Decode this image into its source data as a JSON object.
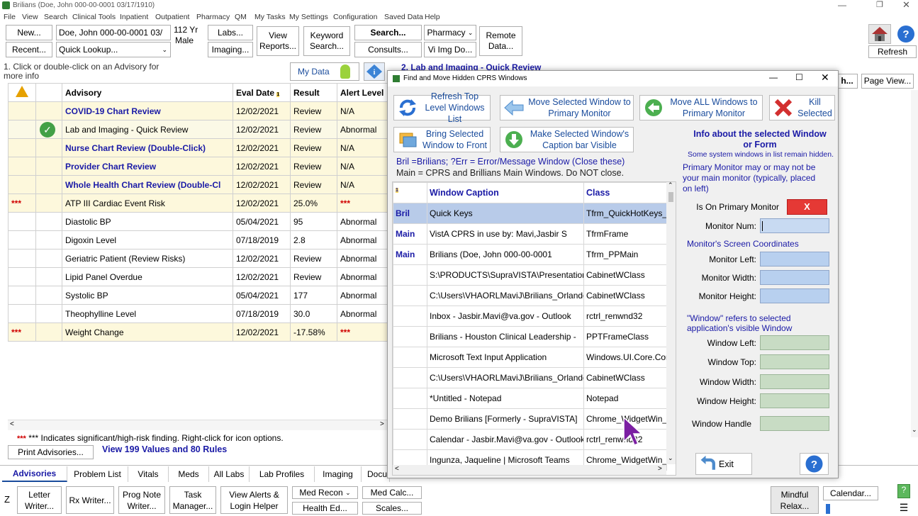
{
  "window": {
    "title": "Brilians (Doe, John  000-00-0001 03/17/1910)"
  },
  "menu": [
    "File",
    "View",
    "Search",
    "Clinical Tools",
    "Inpatient",
    "Outpatient",
    "Pharmacy",
    "QM",
    "My Tasks",
    "My Settings",
    "Configuration",
    "Saved Data",
    "Help"
  ],
  "toolbar": {
    "new": "New...",
    "recent": "Recent...",
    "patient": "Doe, John  000-00-0001  03/",
    "quick_lookup": "Quick Lookup...",
    "age": "112 Yr",
    "sex": "Male",
    "labs": "Labs...",
    "imaging": "Imaging...",
    "view_reports": "View Reports...",
    "keyword_search": "Keyword Search...",
    "search": "Search...",
    "consults": "Consults...",
    "pharmacy": "Pharmacy",
    "vi_img": "Vi Img Do...",
    "remote_data": "Remote Data...",
    "refresh": "Refresh"
  },
  "advisory": {
    "hint": "1. Click or double-click on an Advisory for more info",
    "my_data": "My Data",
    "right_panel_title": "2. Lab and Imaging - Quick Review",
    "right_btn": "h...",
    "page_view": "Page View...",
    "headers": {
      "advisory": "Advisory",
      "eval_date": "Eval Date",
      "result": "Result",
      "alert": "Alert Level"
    },
    "rows": [
      {
        "flag": "",
        "advisory": "COVID-19 Chart Review",
        "date": "12/02/2021",
        "result": "Review",
        "alert": "N/A"
      },
      {
        "flag": "",
        "advisory": "Lab and Imaging - Quick Review",
        "date": "12/02/2021",
        "result": "Review",
        "alert": "Abnormal"
      },
      {
        "flag": "",
        "advisory": "Nurse Chart Review (Double-Click)",
        "date": "12/02/2021",
        "result": "Review",
        "alert": "N/A"
      },
      {
        "flag": "",
        "advisory": "Provider Chart Review",
        "date": "12/02/2021",
        "result": "Review",
        "alert": "N/A"
      },
      {
        "flag": "",
        "advisory": "Whole Health Chart Review (Double-Cl",
        "date": "12/02/2021",
        "result": "Review",
        "alert": "N/A"
      },
      {
        "flag": "***",
        "advisory": "ATP III Cardiac Event Risk",
        "date": "12/02/2021",
        "result": "25.0%",
        "alert": "***"
      },
      {
        "flag": "",
        "advisory": "Diastolic BP",
        "date": "05/04/2021",
        "result": "95",
        "alert": "Abnormal"
      },
      {
        "flag": "",
        "advisory": "Digoxin Level",
        "date": "07/18/2019",
        "result": "2.8",
        "alert": "Abnormal"
      },
      {
        "flag": "",
        "advisory": "Geriatric Patient (Review Risks)",
        "date": "12/02/2021",
        "result": "Review",
        "alert": "Abnormal"
      },
      {
        "flag": "",
        "advisory": "Lipid Panel Overdue",
        "date": "12/02/2021",
        "result": "Review",
        "alert": "Abnormal"
      },
      {
        "flag": "",
        "advisory": "Systolic BP",
        "date": "05/04/2021",
        "result": "177",
        "alert": "Abnormal"
      },
      {
        "flag": "",
        "advisory": "Theophylline Level",
        "date": "07/18/2019",
        "result": "30.0",
        "alert": "Abnormal"
      },
      {
        "flag": "***",
        "advisory": "Weight Change",
        "date": "12/02/2021",
        "result": "-17.58%",
        "alert": "***"
      }
    ],
    "footnote": "*** Indicates significant/high-risk finding. Right-click for icon options.",
    "print": "Print Advisories...",
    "view_values": "View 199 Values and 80 Rules"
  },
  "tabs": [
    "Advisories",
    "Problem List",
    "Vitals",
    "Meds",
    "All Labs",
    "Lab Profiles",
    "Imaging",
    "Docu"
  ],
  "bottom": {
    "z": "Z",
    "letter": "Letter Writer...",
    "rx": "Rx Writer...",
    "prog": "Prog Note Writer...",
    "task": "Task Manager...",
    "alerts": "View Alerts & Login Helper",
    "med_recon": "Med Recon",
    "health_ed": "Health Ed...",
    "med_calc": "Med Calc...",
    "scales": "Scales...",
    "mindful": "Mindful Relax...",
    "calendar": "Calendar..."
  },
  "dialog": {
    "title": "Find and Move Hidden CPRS Windows",
    "btn_refresh": "Refresh Top Level Windows List",
    "btn_move_sel": "Move Selected Window to Primary Monitor",
    "btn_move_all": "Move ALL Windows to Primary Monitor",
    "btn_kill": "Kill Selected",
    "btn_bring": "Bring Selected Window to Front",
    "btn_caption": "Make Selected Window's Caption bar Visible",
    "legend1": "Bril =Brilians; ?Err = Error/Message Window (Close these)",
    "legend2": "Main = CPRS and Brillians Main Windows. Do NOT close.",
    "col_caption": "Window Caption",
    "col_class": "Class",
    "rows": [
      {
        "tag": "Bril",
        "caption": "Quick Keys",
        "class": "Tfrm_QuickHotKeys_"
      },
      {
        "tag": "Main",
        "caption": "VistA CPRS in use by: Mavi,Jasbir S",
        "class": "TfrmFrame"
      },
      {
        "tag": "Main",
        "caption": "Brilians (Doe, John  000-00-0001",
        "class": "Tfrm_PPMain"
      },
      {
        "tag": "",
        "caption": "S:\\PRODUCTS\\SupraVISTA\\Presentation",
        "class": "CabinetWClass"
      },
      {
        "tag": "",
        "caption": "C:\\Users\\VHAORLMaviJ\\Brilians_Orlando",
        "class": "CabinetWClass"
      },
      {
        "tag": "",
        "caption": "Inbox - Jasbir.Mavi@va.gov - Outlook",
        "class": "rctrl_renwnd32"
      },
      {
        "tag": "",
        "caption": "Brilians - Houston Clinical Leadership -",
        "class": "PPTFrameClass"
      },
      {
        "tag": "",
        "caption": "Microsoft Text Input Application",
        "class": "Windows.UI.Core.Cor"
      },
      {
        "tag": "",
        "caption": "C:\\Users\\VHAORLMaviJ\\Brilians_Orlando",
        "class": "CabinetWClass"
      },
      {
        "tag": "",
        "caption": "*Untitled - Notepad",
        "class": "Notepad"
      },
      {
        "tag": "",
        "caption": "Demo Brilians [Formerly - SupraVISTA]",
        "class": "Chrome_WidgetWin_"
      },
      {
        "tag": "",
        "caption": "Calendar - Jasbir.Mavi@va.gov - Outlook",
        "class": "rctrl_renwnd32"
      },
      {
        "tag": "",
        "caption": "Ingunza, Jaqueline | Microsoft Teams",
        "class": "Chrome_WidgetWin_"
      }
    ],
    "info_title": "Info about the selected Window  or Form",
    "info_sub": "Some system windows in list remain hidden.",
    "primary_note": "Primary Monitor may or may not be your main monitor  (typically, placed on left)",
    "is_primary": "Is On Primary Monitor",
    "is_primary_val": "X",
    "monitor_num": "Monitor Num:",
    "coords": "Monitor's Screen Coordinates",
    "monitor_left": "Monitor Left:",
    "monitor_width": "Monitor Width:",
    "monitor_height": "Monitor Height:",
    "window_note": "\"Window\" refers to selected application's visible Window",
    "window_left": "Window Left:",
    "window_top": "Window Top:",
    "window_width": "Window Width:",
    "window_height": "Window Height:",
    "window_handle": "Window Handle",
    "exit": "Exit"
  }
}
